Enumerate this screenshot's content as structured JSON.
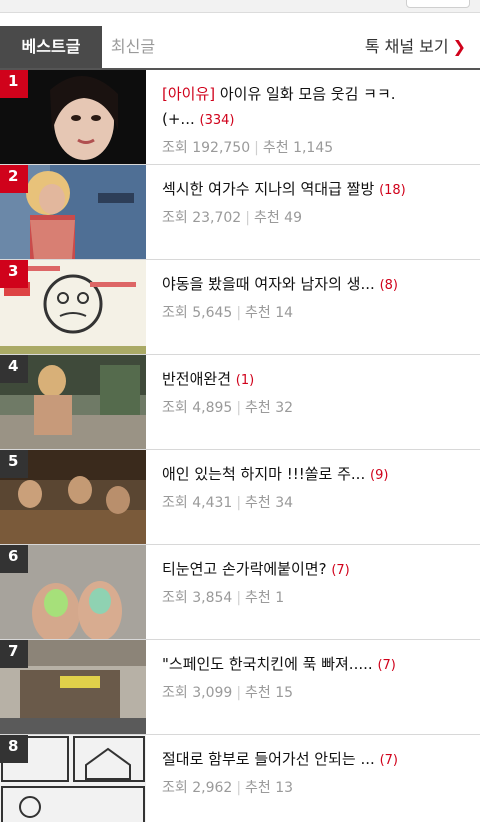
{
  "tabs": {
    "best": "베스트글",
    "latest": "최신글",
    "talk_channel": "톡 채널 보기"
  },
  "posts": [
    {
      "rank": "1",
      "tag": "[아이유]",
      "title": " 아이유 일화 모음 웃김 ㅋㅋ.",
      "title2": "(+...",
      "comments": "(334)",
      "views_label": "조회",
      "views": "192,750",
      "rec_label": "추천",
      "rec": "1,145"
    },
    {
      "rank": "2",
      "tag": "",
      "title": "섹시한 여가수 지나의 역대급 짤방",
      "title2": "",
      "comments": "(18)",
      "views_label": "조회",
      "views": "23,702",
      "rec_label": "추천",
      "rec": "49"
    },
    {
      "rank": "3",
      "tag": "",
      "title": "야동을 봤을때 여자와 남자의 생...",
      "title2": "",
      "comments": "(8)",
      "views_label": "조회",
      "views": "5,645",
      "rec_label": "추천",
      "rec": "14"
    },
    {
      "rank": "4",
      "tag": "",
      "title": "반전애완견",
      "title2": "",
      "comments": "(1)",
      "views_label": "조회",
      "views": "4,895",
      "rec_label": "추천",
      "rec": "32"
    },
    {
      "rank": "5",
      "tag": "",
      "title": "애인 있는척 하지마 !!!쏠로 주...",
      "title2": "",
      "comments": "(9)",
      "views_label": "조회",
      "views": "4,431",
      "rec_label": "추천",
      "rec": "34"
    },
    {
      "rank": "6",
      "tag": "",
      "title": "티눈연고 손가락에붙이면?",
      "title2": "",
      "comments": "(7)",
      "views_label": "조회",
      "views": "3,854",
      "rec_label": "추천",
      "rec": "1"
    },
    {
      "rank": "7",
      "tag": "",
      "title": "\"스페인도 한국치킨에 푹 빠져.....",
      "title2": "",
      "comments": "(7)",
      "views_label": "조회",
      "views": "3,099",
      "rec_label": "추천",
      "rec": "15"
    },
    {
      "rank": "8",
      "tag": "",
      "title": "절대로 함부로 들어가선 안되는 ...",
      "title2": "",
      "comments": "(7)",
      "views_label": "조회",
      "views": "2,962",
      "rec_label": "추천",
      "rec": "13"
    }
  ],
  "colors": {
    "accent": "#d0021b",
    "tab_active_bg": "#4a4a4a",
    "meta_text": "#9a9a9a"
  }
}
